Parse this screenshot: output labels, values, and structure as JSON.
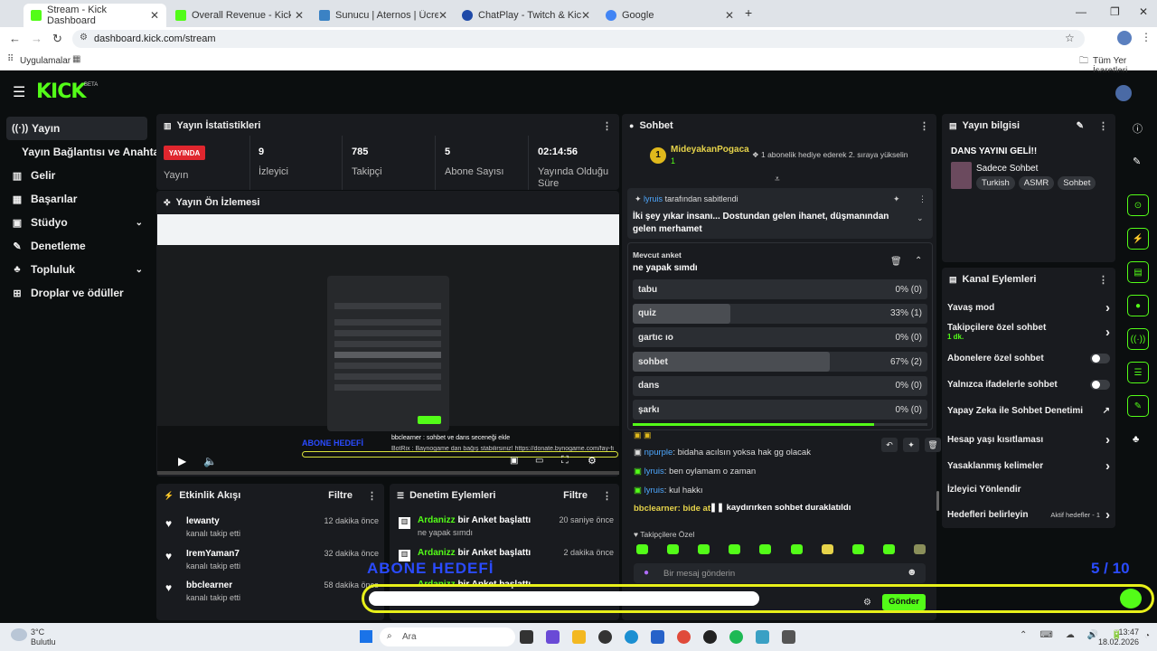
{
  "browser": {
    "tabs": [
      {
        "title": "Stream - Kick Dashboard",
        "fav": "#53fc18"
      },
      {
        "title": "Overall Revenue - Kick Dashboard",
        "fav": "#53fc18"
      },
      {
        "title": "Sunucu | Aternos | Ücretsiz Min",
        "fav": "#3b82c4"
      },
      {
        "title": "ChatPlay - Twitch & Kick İzleyici",
        "fav": "#1f4aa8"
      },
      {
        "title": "Google",
        "fav": "#4285f4"
      }
    ],
    "url": "dashboard.kick.com/stream",
    "bookmarks_left": "Uygulamalar",
    "bookmarks_right": "Tüm Yer İşaretleri"
  },
  "app": {
    "logo": "KICK",
    "beta": "BETA"
  },
  "sidebar": {
    "items": [
      {
        "label": "Yayın",
        "icon": "broadcast-icon"
      },
      {
        "label": "Yayın Bağlantısı ve Anahtarı",
        "icon": ""
      },
      {
        "label": "Gelir",
        "icon": "chart-icon"
      },
      {
        "label": "Başarılar",
        "icon": "trophy-icon"
      },
      {
        "label": "Stüdyo",
        "icon": "studio-icon"
      },
      {
        "label": "Denetleme",
        "icon": "wrench-icon"
      },
      {
        "label": "Topluluk",
        "icon": "people-icon"
      },
      {
        "label": "Droplar ve ödüller",
        "icon": "gift-icon"
      }
    ]
  },
  "stats": {
    "title": "Yayın İstatistikleri",
    "live_badge": "YAYINDA",
    "live_label": "Yayın",
    "items": [
      {
        "value": "9",
        "label": "İzleyici"
      },
      {
        "value": "785",
        "label": "Takipçi"
      },
      {
        "value": "5",
        "label": "Abone Sayısı"
      },
      {
        "value": "02:14:56",
        "label": "Yayında Olduğu Süre"
      }
    ]
  },
  "preview": {
    "title": "Yayın Ön İzlemesi",
    "overlay_goal": "ABONE HEDEFİ",
    "overlay_chat1": "bbclearner : sohbet ve dans seceneği ekle",
    "overlay_chat2": "BotRix : Baynogame dan bağış stabilirsiniz! https://donate.bynogame.com/fay-fi"
  },
  "activity": {
    "title": "Etkinlik Akışı",
    "filter": "Filtre",
    "events": [
      {
        "name": "lewanty",
        "sub": "kanalı takip etti",
        "time": "12 dakika önce"
      },
      {
        "name": "IremYaman7",
        "sub": "kanalı takip etti",
        "time": "32 dakika önce"
      },
      {
        "name": "bbclearner",
        "sub": "kanalı takip etti",
        "time": "58 dakika önce"
      }
    ]
  },
  "moderation": {
    "title": "Denetim Eylemleri",
    "filter": "Filtre",
    "events": [
      {
        "name": "Ardanizz",
        "action": "bir Anket başlattı",
        "sub": "ne yapak sımdı",
        "time": "20 saniye önce"
      },
      {
        "name": "Ardanizz",
        "action": "bir Anket başlattı",
        "sub": "",
        "time": "2 dakika önce"
      },
      {
        "name": "Ardanizz",
        "action": "bir Anket başlattı",
        "sub": "",
        "time": ""
      }
    ]
  },
  "chat": {
    "title": "Sohbet",
    "gifter": {
      "name": "MideyakanPogaca",
      "count": "1",
      "message": "1 abonelik hediye ederek 2. sıraya yükselin"
    },
    "pinned": {
      "by": "lyruis",
      "label": "tarafından sabitlendi",
      "text": "İki şey yıkar insanı... Dostundan gelen ihanet, düşmanından gelen merhamet"
    },
    "poll": {
      "label": "Mevcut anket",
      "question": "ne yapak sımdı",
      "options": [
        {
          "label": "tabu",
          "pct": "0% (0)",
          "fill": 0
        },
        {
          "label": "quiz",
          "pct": "33% (1)",
          "fill": 0.33
        },
        {
          "label": "gartıc ıo",
          "pct": "0% (0)",
          "fill": 0
        },
        {
          "label": "sohbet",
          "pct": "67% (2)",
          "fill": 0.67
        },
        {
          "label": "dans",
          "pct": "0% (0)",
          "fill": 0
        },
        {
          "label": "şarkı",
          "pct": "0% (0)",
          "fill": 0
        }
      ],
      "progress": 0.82
    },
    "messages": [
      {
        "user": "npurple",
        "text": "bidaha acılsın yoksa hak gg olacak"
      },
      {
        "user": "lyruis",
        "text": "ben oylamam o zaman"
      },
      {
        "user": "lyruis",
        "text": "kul hakkı"
      }
    ],
    "paused_prefix": "bbclearner: bide at",
    "paused": "kaydırırken sohbet duraklatıldı",
    "followers_only": "Takipçilere Özel",
    "placeholder": "Bir mesaj gönderin",
    "send": "Gönder"
  },
  "overlay_bottom": {
    "goal": "ABONE HEDEFİ",
    "count": "5 / 10"
  },
  "stream_info": {
    "title": "Yayın bilgisi",
    "stream_title": "DANS YAYINI GELİ!!",
    "category": "Sadece Sohbet",
    "tags": [
      "Turkish",
      "ASMR",
      "Sohbet"
    ]
  },
  "channel_actions": {
    "title": "Kanal Eylemleri",
    "items": [
      {
        "label": "Yavaş mod",
        "control": "chevron",
        "sub": ""
      },
      {
        "label": "Takipçilere özel sohbet",
        "control": "chevron",
        "sub": "1 dk."
      },
      {
        "label": "Abonelere özel sohbet",
        "control": "toggle",
        "sub": ""
      },
      {
        "label": "Yalnızca ifadelerle sohbet",
        "control": "toggle",
        "sub": ""
      },
      {
        "label": "Yapay Zeka ile Sohbet Denetimi",
        "control": "external",
        "sub": ""
      },
      {
        "label": "Hesap yaşı kısıtlaması",
        "control": "chevron",
        "sub": ""
      },
      {
        "label": "Yasaklanmış kelimeler",
        "control": "chevron",
        "sub": ""
      },
      {
        "label": "İzleyici Yönlendir",
        "control": "none",
        "sub": ""
      },
      {
        "label": "Hedefleri belirleyin",
        "control": "chevron",
        "sub": "Aktif hedefler - 1"
      }
    ]
  },
  "taskbar": {
    "weather_temp": "3°C",
    "weather_desc": "Bulutlu",
    "search": "Ara",
    "time": "13:47",
    "date": "18.02.2026"
  },
  "colors": {
    "accent": "#53fc18",
    "live": "#e0262e",
    "username": "#4ea8ff",
    "bg": "#0b0e0f",
    "panel": "#191b1f"
  }
}
